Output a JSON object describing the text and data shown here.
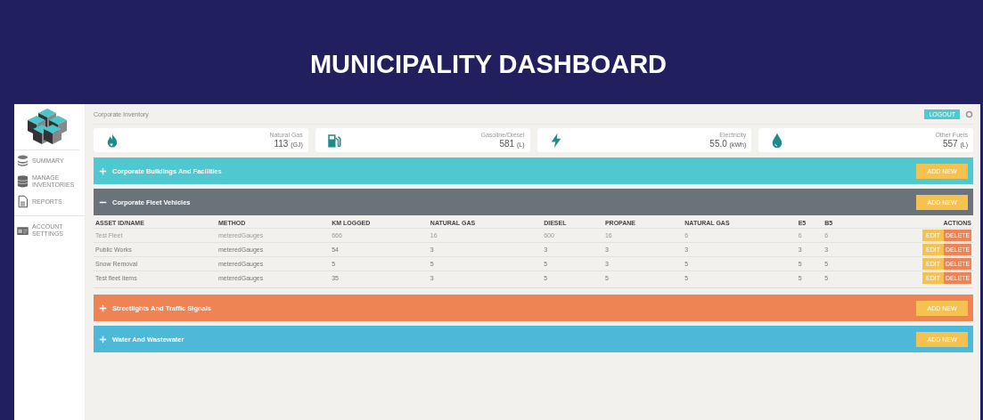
{
  "title": "MUNICIPALITY DASHBOARD",
  "sidebar": {
    "items": [
      {
        "label": "SUMMARY"
      },
      {
        "label": "MANAGE INVENTORIES"
      },
      {
        "label": "REPORTS"
      },
      {
        "label": "ACCOUNT SETTINGS"
      }
    ]
  },
  "header": {
    "title": "Corporate Inventory",
    "button": "LOGOUT"
  },
  "cards": [
    {
      "label": "Natural Gas",
      "value": "113",
      "unit": "(GJ)"
    },
    {
      "label": "Gasoline/Diesel",
      "value": "581",
      "unit": "(L)"
    },
    {
      "label": "Electricity",
      "value": "55.0",
      "unit": "(kWh)"
    },
    {
      "label": "Other Fuels",
      "value": "557",
      "unit": "(L)"
    }
  ],
  "sections": [
    {
      "title": "Corporate Buildings And Facilities",
      "color": "#4fc8cf",
      "expanded": false,
      "button": "ADD NEW"
    },
    {
      "title": "Corporate Fleet Vehicles",
      "color": "#6b737a",
      "expanded": true,
      "button": "ADD NEW",
      "table": {
        "columns": [
          "ASSET ID/NAME",
          "METHOD",
          "KM LOGGED",
          "NATURAL GAS",
          "DIESEL",
          "PROPANE",
          "NATURAL GAS",
          "E5",
          "B5",
          "ACTIONS"
        ],
        "rows": [
          {
            "cells": [
              "Test Fleet",
              "meteredGauges",
              "666",
              "16",
              "600",
              "16",
              "6",
              "6",
              "6"
            ],
            "actions": [
              "EDIT",
              "DELETE"
            ]
          },
          {
            "cells": [
              "Public Works",
              "meteredGauges",
              "54",
              "3",
              "3",
              "3",
              "3",
              "3",
              "3"
            ],
            "actions": [
              "EDIT",
              "DELETE"
            ]
          },
          {
            "cells": [
              "Snow Removal",
              "meteredGauges",
              "5",
              "5",
              "5",
              "3",
              "5",
              "5",
              "5"
            ],
            "actions": [
              "EDIT",
              "DELETE"
            ]
          },
          {
            "cells": [
              "Test fleet items",
              "meteredGauges",
              "35",
              "3",
              "5",
              "5",
              "5",
              "5",
              "5"
            ],
            "actions": [
              "EDIT",
              "DELETE"
            ]
          }
        ]
      }
    },
    {
      "title": "Streetlights And Traffic Signals",
      "color": "#ef8354",
      "expanded": false,
      "button": "ADD NEW"
    },
    {
      "title": "Water And Wastewater",
      "color": "#4db8d8",
      "expanded": false,
      "button": "ADD NEW"
    }
  ]
}
